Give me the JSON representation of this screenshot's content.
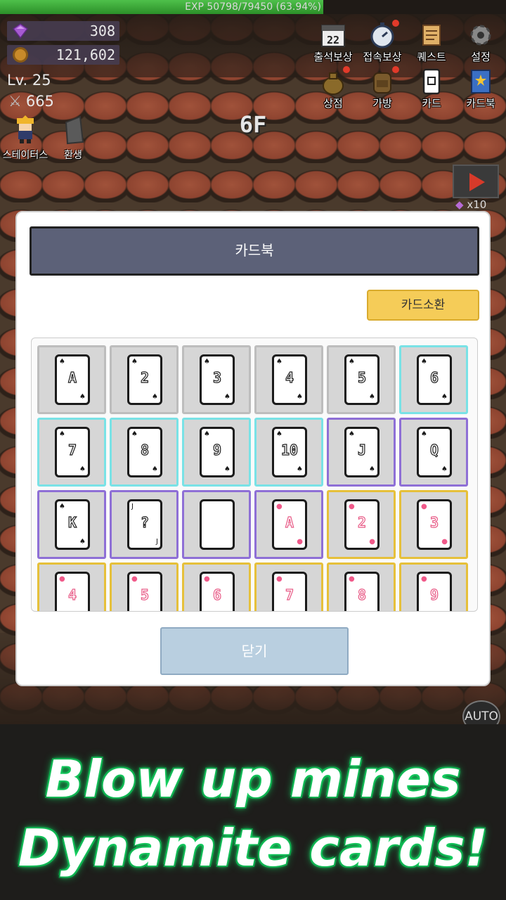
{
  "exp": {
    "text": "EXP 50798/79450 (63.94%)",
    "percent": 63.94
  },
  "resources": {
    "gems": "308",
    "gold": "121,602"
  },
  "player": {
    "level": "Lv. 25",
    "attack": "665"
  },
  "left_buttons": [
    {
      "label": "스테이터스",
      "icon": "character-icon"
    },
    {
      "label": "환생",
      "icon": "tombstone-icon"
    }
  ],
  "floor": "6F",
  "top_menu": [
    {
      "label": "출석보상",
      "icon": "calendar-icon",
      "calendar_day": "22"
    },
    {
      "label": "접속보상",
      "icon": "stopwatch-icon"
    },
    {
      "label": "퀘스트",
      "icon": "scroll-icon"
    },
    {
      "label": "설정",
      "icon": "gear-icon"
    },
    {
      "label": "상점",
      "icon": "money-bag-icon"
    },
    {
      "label": "가방",
      "icon": "backpack-icon"
    },
    {
      "label": "카드",
      "icon": "card-icon"
    },
    {
      "label": "카드북",
      "icon": "book-icon"
    }
  ],
  "video_reward": {
    "label": "x10",
    "icon": "video-play-icon"
  },
  "auto_label": "AUTO",
  "dialog": {
    "title": "카드북",
    "summon_label": "카드소환",
    "close_label": "닫기",
    "cards": [
      {
        "rank": "A",
        "suit": "spade",
        "tier": "gray"
      },
      {
        "rank": "2",
        "suit": "spade",
        "tier": "gray"
      },
      {
        "rank": "3",
        "suit": "spade",
        "tier": "gray"
      },
      {
        "rank": "4",
        "suit": "spade",
        "tier": "gray"
      },
      {
        "rank": "5",
        "suit": "spade",
        "tier": "gray"
      },
      {
        "rank": "6",
        "suit": "spade",
        "tier": "cyan"
      },
      {
        "rank": "7",
        "suit": "spade",
        "tier": "cyan"
      },
      {
        "rank": "8",
        "suit": "spade",
        "tier": "cyan"
      },
      {
        "rank": "9",
        "suit": "spade",
        "tier": "cyan"
      },
      {
        "rank": "10",
        "suit": "spade",
        "tier": "cyan"
      },
      {
        "rank": "J",
        "suit": "spade",
        "tier": "purple"
      },
      {
        "rank": "Q",
        "suit": "spade",
        "tier": "purple"
      },
      {
        "rank": "K",
        "suit": "spade",
        "tier": "purple"
      },
      {
        "rank": "?",
        "suit": "joker",
        "tier": "purple"
      },
      {
        "rank": "",
        "suit": "blank",
        "tier": "purple"
      },
      {
        "rank": "A",
        "suit": "heart",
        "tier": "purple"
      },
      {
        "rank": "2",
        "suit": "heart",
        "tier": "gold"
      },
      {
        "rank": "3",
        "suit": "heart",
        "tier": "gold"
      },
      {
        "rank": "4",
        "suit": "heart",
        "tier": "gold"
      },
      {
        "rank": "5",
        "suit": "heart",
        "tier": "gold"
      },
      {
        "rank": "6",
        "suit": "heart",
        "tier": "gold"
      },
      {
        "rank": "7",
        "suit": "heart",
        "tier": "gold"
      },
      {
        "rank": "8",
        "suit": "heart",
        "tier": "gold"
      },
      {
        "rank": "9",
        "suit": "heart",
        "tier": "gold"
      }
    ]
  },
  "promo": {
    "line1": "Blow up mines",
    "line2": "Dynamite cards!"
  },
  "colors": {
    "exp_green": "#3aa836",
    "dialog_title_bg": "#5c6178",
    "summon_bg": "#f5cc58",
    "close_bg": "#b9cfe0",
    "promo_glow": "#1ae06a"
  }
}
